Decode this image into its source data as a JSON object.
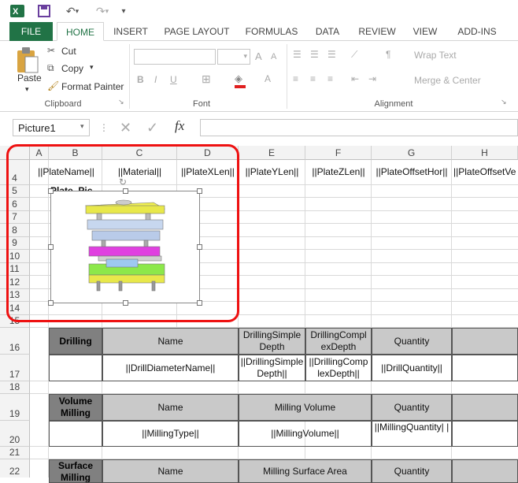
{
  "qat": {
    "excel_icon": "excel-icon",
    "save": "save-icon",
    "undo": "undo-icon",
    "redo": "redo-icon",
    "customize": "customize-icon"
  },
  "tabs": [
    "FILE",
    "HOME",
    "INSERT",
    "PAGE LAYOUT",
    "FORMULAS",
    "DATA",
    "REVIEW",
    "VIEW",
    "ADD-INS"
  ],
  "clipboard": {
    "paste": "Paste",
    "cut": "Cut",
    "copy": "Copy",
    "format_painter": "Format Painter",
    "label": "Clipboard"
  },
  "font": {
    "label": "Font",
    "bold": "B",
    "italic": "I",
    "underline": "U",
    "grow": "A",
    "shrink": "A"
  },
  "alignment": {
    "wrap_text": "Wrap Text",
    "merge_center": "Merge & Center",
    "label": "Alignment"
  },
  "formula_bar": {
    "name_box": "Picture1",
    "fx": "fx",
    "formula": ""
  },
  "columns": [
    "A",
    "B",
    "C",
    "D",
    "E",
    "F",
    "G",
    "H"
  ],
  "rows": [
    "4",
    "5",
    "6",
    "7",
    "8",
    "9",
    "10",
    "11",
    "12",
    "13",
    "14",
    "15",
    "16",
    "17",
    "18",
    "19",
    "20",
    "21",
    "22"
  ],
  "row4": [
    "||PlateName||",
    "||Material||",
    "||PlateXLen||",
    "||PlateYLen||",
    "||PlateZLen||",
    "||PlateOffsetHor||",
    "||PlateOffsetVe"
  ],
  "row5_text": "Plate_Pic",
  "drilling": {
    "title": "Drilling",
    "name": "Name",
    "simple": "DrillingSimple Depth",
    "complex": "DrillingCompl exDepth",
    "quantity": "Quantity"
  },
  "drilling_values": {
    "name": "||DrillDiameterName||",
    "simple": "||DrillingSimple Depth||",
    "complex": "||DrillingComp lexDepth||",
    "quantity": "||DrillQuantity||"
  },
  "volume": {
    "title": "Volume Milling",
    "name": "Name",
    "volume": "Milling Volume",
    "quantity": "Quantity"
  },
  "volume_values": {
    "name": "||MillingType||",
    "volume": "||MillingVolume||",
    "quantity": "||MillingQuantity| |"
  },
  "surface": {
    "title": "Surface Milling",
    "name": "Name",
    "area": "Milling Surface Area",
    "quantity": "Quantity"
  },
  "colors": {
    "excel_green": "#217346",
    "highlight_red": "#e11111",
    "header_gray": "#c9c9c9",
    "title_gray": "#808080"
  }
}
